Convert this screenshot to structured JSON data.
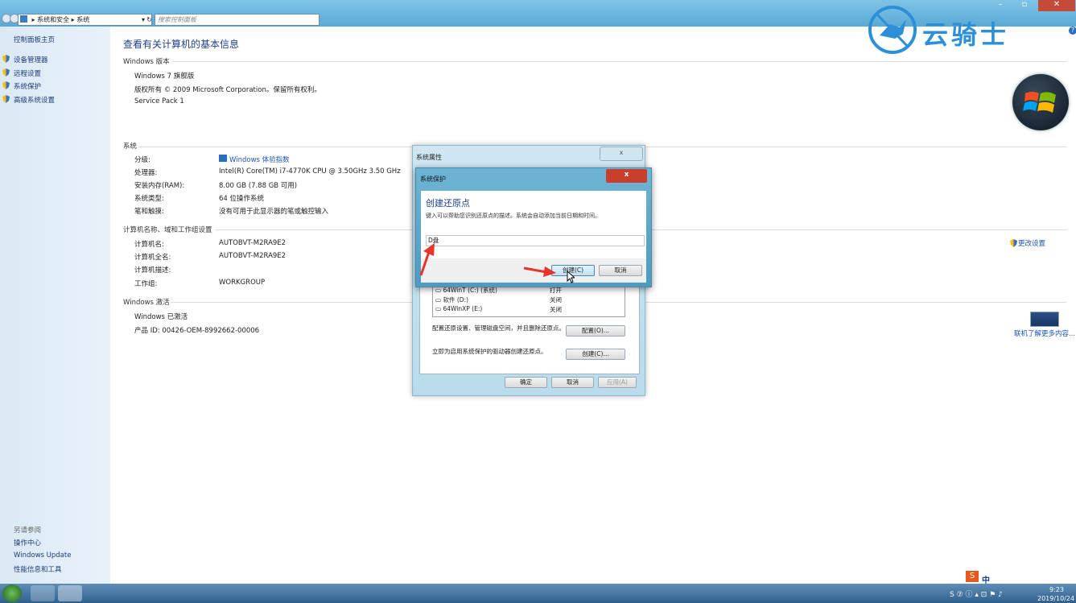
{
  "address": {
    "path1": "系统和安全",
    "path2": "系统"
  },
  "search": {
    "placeholder": "搜索控制面板"
  },
  "watermark": {
    "text": "云骑士"
  },
  "left_pane": {
    "home": "控制面板主页",
    "links": [
      "设备管理器",
      "远程设置",
      "系统保护",
      "高级系统设置"
    ],
    "see_also": "另请参阅",
    "see_also_links": [
      "操作中心",
      "Windows Update",
      "性能信息和工具"
    ]
  },
  "main": {
    "title": "查看有关计算机的基本信息",
    "edition_header": "Windows 版本",
    "edition": "Windows 7 旗舰版",
    "copyright": "版权所有 © 2009 Microsoft Corporation。保留所有权利。",
    "service_pack": "Service Pack 1",
    "system_header": "系统",
    "rating_label": "分级:",
    "rating_value": "Windows 体验指数",
    "processor_label": "处理器:",
    "processor_value": "Intel(R) Core(TM) i7-4770K CPU @ 3.50GHz   3.50 GHz",
    "ram_label": "安装内存(RAM):",
    "ram_value": "8.00 GB (7.88 GB 可用)",
    "type_label": "系统类型:",
    "type_value": "64 位操作系统",
    "pen_label": "笔和触摸:",
    "pen_value": "没有可用于此显示器的笔或触控输入",
    "computer_header": "计算机名称、域和工作组设置",
    "name_label": "计算机名:",
    "name_value": "AUTOBVT-M2RA9E2",
    "fullname_label": "计算机全名:",
    "fullname_value": "AUTOBVT-M2RA9E2",
    "desc_label": "计算机描述:",
    "workgroup_label": "工作组:",
    "workgroup_value": "WORKGROUP",
    "change_settings": "更改设置",
    "activation_header": "Windows 激活",
    "activated": "Windows 已激活",
    "product_id": "产品 ID: 00426-OEM-8992662-00006",
    "learn_more": "联机了解更多内容..."
  },
  "sys_props": {
    "title": "系统属性",
    "close": "x",
    "drives": [
      {
        "name": "64WinT (C:) (系统)",
        "status": "打开"
      },
      {
        "name": "软件 (D:)",
        "status": "关闭"
      },
      {
        "name": "64WinXP (E:)",
        "status": "关闭"
      }
    ],
    "config_text": "配置还原设置、管理磁盘空间，并且删除还原点。",
    "config_btn": "配置(O)...",
    "create_text": "立即为启用系统保护的驱动器创建还原点。",
    "create_btn": "创建(C)...",
    "ok": "确定",
    "cancel": "取消",
    "apply": "应用(A)"
  },
  "restore_dialog": {
    "title": "系统保护",
    "close": "x",
    "heading": "创建还原点",
    "description": "键入可以帮助您识别还原点的描述。系统会自动添加当前日期和时间。",
    "input_value": "D盘",
    "create": "创建(C)",
    "cancel": "取消"
  },
  "taskbar": {
    "time": "9:23",
    "date": "2019/10/24",
    "ime": "中"
  },
  "colors": {
    "accent": "#1f6fc6",
    "arrow": "#e8322c",
    "dialog_close": "#c8402c"
  }
}
